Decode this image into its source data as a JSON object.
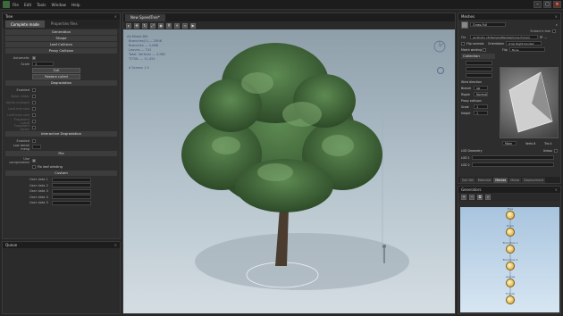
{
  "menubar": {
    "items": [
      "File",
      "Edit",
      "Tools",
      "Window",
      "Help"
    ]
  },
  "left_panel": {
    "title": "Tree",
    "tabs": [
      "Complete mode",
      "Properties files"
    ],
    "sections": {
      "generation": "Generation",
      "shape": "Shape",
      "leaf_collision": "Leaf Collision",
      "proxy_collision": "Proxy Collision",
      "degradation": "Degradation",
      "interactive_degradation": "Interactive Degradation",
      "file": "File",
      "custom": "Custom"
    },
    "automatic_label": "Automatic",
    "scale_label": "Scale",
    "scale_value": "1",
    "cull_button": "Cull",
    "restore_culled_button": "Restore culled",
    "enabled_label": "Enabled",
    "degradation_fields": [
      "Basic slider",
      "Alpha cullback",
      "Leaf min size",
      "Leaf max size",
      "Fragment cutoff",
      "Fragment factor"
    ],
    "low_detail_label": "Low detail mesg",
    "use_compression_label": "Use compression",
    "fix_leaf_winding_label": "Fix leaf winding",
    "user_data": [
      "User data 1",
      "User data 2",
      "User data 3",
      "User data 4",
      "User data 5"
    ]
  },
  "queue_panel": {
    "title": "Queue"
  },
  "viewport": {
    "tab_label": "New SpeedTree*",
    "stats": {
      "title": "All-Mixed-DN",
      "lines": [
        "Branches(1) — 2506",
        "Branches — 2,066",
        "Leaves — 741",
        "Total: Vertices — 4,962",
        "TOTAL — 11,451",
        "",
        "A Screen 1.5"
      ]
    },
    "colors": {
      "sky_top": "#8a9ba6",
      "ground": "#d4dde2"
    }
  },
  "meshes_panel": {
    "title": "Meshes",
    "mesh_name": "Cross-Full",
    "embed_label": "Embed in tree",
    "file_label": "File",
    "file_path": "es.Studio v5/Sample/Meshes/Cross-Full.sm",
    "flip_normals_label": "Flip normals",
    "orientation_label": "Orientation",
    "orientation_value": "Z-Up Right-handed",
    "match_winding_label": "Match winding",
    "flip_label": "Flip",
    "flip_value": "None",
    "collection_label": "Collection",
    "wind_direction_label": "Wind direction",
    "branch_label": "Branch",
    "branch_value": "up",
    "ripple_label": "Ripple",
    "ripple_value": "Normal",
    "proxy_collision_label": "Proxy collision",
    "scale_label": "Scale",
    "scale_value": "1",
    "height_label": "Height",
    "height_value": "1",
    "main_label": "Main",
    "verts_label": "Verts 8",
    "tris_label": "Tris 4",
    "lod_geometry_label": "LOD Geometry",
    "unbox_label": "Unbox",
    "lod1_label": "LOD 1",
    "lod2_label": "LOD 2"
  },
  "right_tabs": {
    "items": [
      "Gen Set",
      "Materials",
      "Meshes",
      "Masks",
      "Displacement"
    ]
  },
  "generators_panel": {
    "title": "Generators",
    "nodes": [
      "Tree",
      "Trunk",
      "Branches 1",
      "Branches 2",
      "Leaves",
      "Fronds"
    ]
  }
}
